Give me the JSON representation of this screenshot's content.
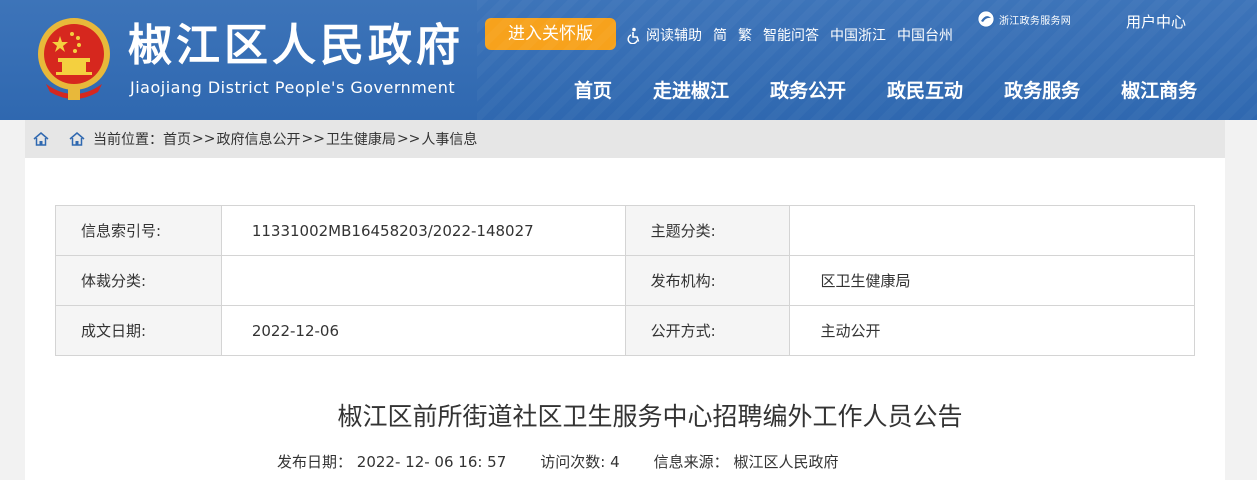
{
  "header": {
    "title": "椒江区人民政府",
    "subtitle": "Jiaojiang District People's Government",
    "care_button": "进入关怀版",
    "toplinks": [
      "阅读辅助",
      "简",
      "繁",
      "智能问答",
      "中国浙江",
      "中国台州"
    ],
    "zj_logo_text": "浙江政务服务网",
    "user_center": "用户中心",
    "nav": [
      "首页",
      "走进椒江",
      "政务公开",
      "政民互动",
      "政务服务",
      "椒江商务"
    ],
    "colors": {
      "bg": "#3370b7",
      "accent": "#f7a21c"
    }
  },
  "breadcrumb": {
    "prefix": "当前位置：",
    "items": [
      "首页",
      "政府信息公开",
      "卫生健康局",
      "人事信息"
    ],
    "separator": ">>"
  },
  "meta": {
    "rows": [
      {
        "label1": "信息索引号:",
        "value1": "11331002MB16458203/2022-148027",
        "label2": "主题分类:",
        "value2": ""
      },
      {
        "label1": "体裁分类:",
        "value1": "",
        "label2": "发布机构:",
        "value2": "区卫生健康局"
      },
      {
        "label1": "成文日期:",
        "value1": "2022-12-06",
        "label2": "公开方式:",
        "value2": "主动公开"
      }
    ]
  },
  "article": {
    "title": "椒江区前所街道社区卫生服务中心招聘编外工作人员公告",
    "publish_label": "发布日期：",
    "publish_date": "2022- 12- 06 16: 57",
    "visits_label": "访问次数:",
    "visits": "4",
    "source_label": "信息来源：",
    "source": "椒江区人民政府"
  }
}
